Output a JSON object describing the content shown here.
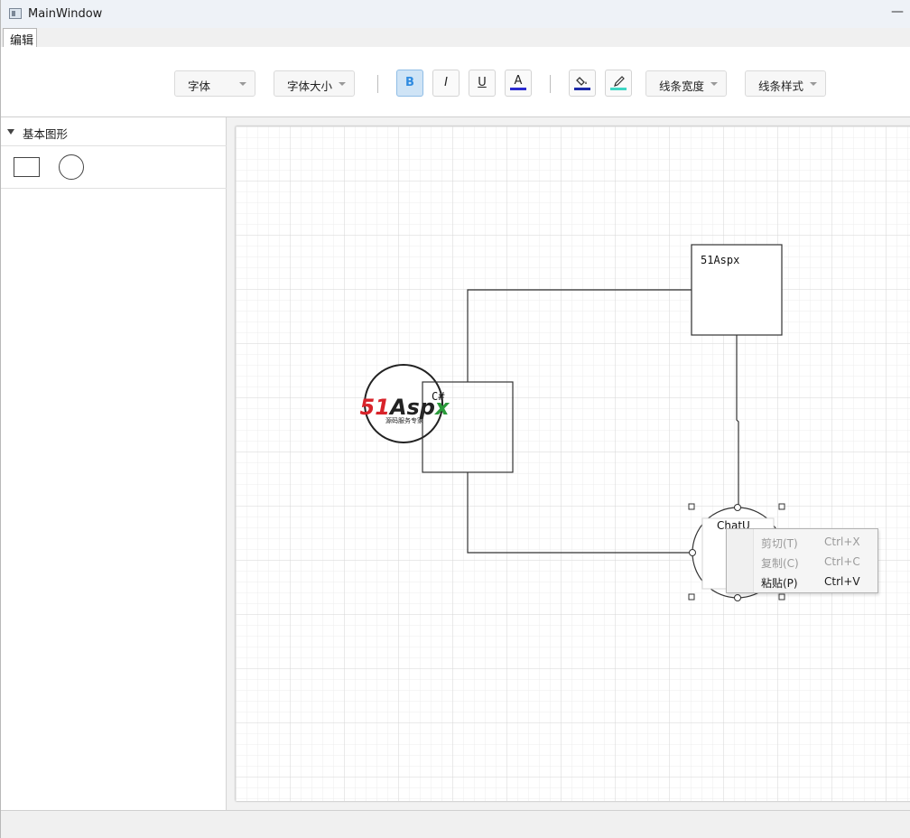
{
  "window": {
    "title": "MainWindow",
    "minimize_glyph": "—"
  },
  "ribbon": {
    "tab_label": "编辑",
    "font_dropdown": "字体",
    "font_size_dropdown": "字体大小",
    "bold_label": "B",
    "italic_label": "I",
    "underline_label": "U",
    "font_color_label": "A",
    "font_color": "#2a2ad0",
    "fill_color": "#1c2aa8",
    "line_color": "#3fd6c4",
    "line_width_dropdown": "线条宽度",
    "line_style_dropdown": "线条样式"
  },
  "sidebar": {
    "section_title": "基本图形",
    "shapes": [
      "rectangle-shape",
      "circle-shape"
    ]
  },
  "canvas": {
    "node_top_right_text": "51Aspx",
    "node_left_text": "C#",
    "logo_text": "51Aspx",
    "logo_subtext": "源码服务专家",
    "logo_red": "#d8232a",
    "logo_green": "#2a9a3a",
    "editing_text": "ChatU"
  },
  "context_menu": {
    "items": [
      {
        "label": "剪切(T)",
        "shortcut": "Ctrl+X",
        "enabled": false
      },
      {
        "label": "复制(C)",
        "shortcut": "Ctrl+C",
        "enabled": false
      },
      {
        "label": "粘贴(P)",
        "shortcut": "Ctrl+V",
        "enabled": true
      }
    ]
  }
}
